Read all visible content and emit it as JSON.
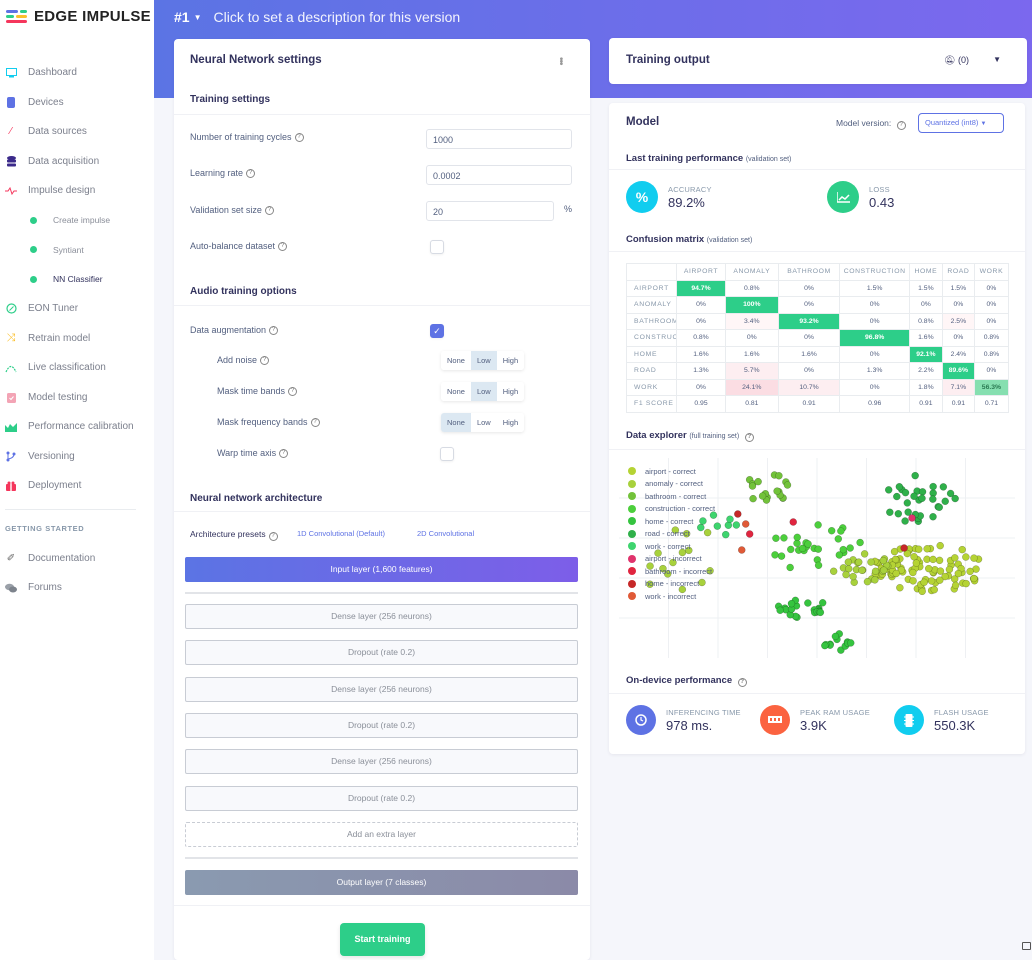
{
  "brand": {
    "name": "EDGE IMPULSE"
  },
  "sidebar": {
    "items": [
      {
        "label": "Dashboard",
        "icon": "monitor-icon",
        "color": "#11cdef"
      },
      {
        "label": "Devices",
        "icon": "device-icon",
        "color": "#5e72e4"
      },
      {
        "label": "Data sources",
        "icon": "data-sources-icon",
        "color": "#f5365c"
      },
      {
        "label": "Data acquisition",
        "icon": "database-icon",
        "color": "#3b2a8a"
      },
      {
        "label": "Impulse design",
        "icon": "pulse-icon",
        "color": "#f5365c"
      }
    ],
    "sub_items": [
      {
        "label": "Create impulse"
      },
      {
        "label": "Syntiant"
      },
      {
        "label": "NN Classifier",
        "active": true
      }
    ],
    "items2": [
      {
        "label": "EON Tuner",
        "icon": "compass-icon",
        "color": "#2dce89"
      },
      {
        "label": "Retrain model",
        "icon": "shuffle-icon",
        "color": "#fbc02d"
      },
      {
        "label": "Live classification",
        "icon": "live-icon",
        "color": "#2dce89"
      },
      {
        "label": "Model testing",
        "icon": "clipboard-check-icon",
        "color": "#f3a4b5"
      },
      {
        "label": "Performance calibration",
        "icon": "chart-area-icon",
        "color": "#2dce89"
      },
      {
        "label": "Versioning",
        "icon": "branch-icon",
        "color": "#5e72e4"
      },
      {
        "label": "Deployment",
        "icon": "gift-icon",
        "color": "#f5365c"
      }
    ],
    "getting_started_heading": "GETTING STARTED",
    "getting_started": [
      {
        "label": "Documentation",
        "icon": "docs-icon"
      },
      {
        "label": "Forums",
        "icon": "forums-icon"
      }
    ]
  },
  "header": {
    "version": "#1",
    "description": "Click to set a description for this version"
  },
  "nn": {
    "title": "Neural Network settings",
    "training_settings_heading": "Training settings",
    "fields": {
      "cycles_label": "Number of training cycles",
      "cycles_value": "1000",
      "lr_label": "Learning rate",
      "lr_value": "0.0002",
      "val_label": "Validation set size",
      "val_value": "20",
      "val_unit": "%",
      "autobalance_label": "Auto-balance dataset",
      "autobalance_checked": false
    },
    "audio_heading": "Audio training options",
    "audio": {
      "augmentation_label": "Data augmentation",
      "augmentation_checked": true,
      "options": [
        "None",
        "Low",
        "High"
      ],
      "add_noise_label": "Add noise",
      "add_noise_selected": "Low",
      "mask_time_label": "Mask time bands",
      "mask_time_selected": "Low",
      "mask_freq_label": "Mask frequency bands",
      "mask_freq_selected": "None",
      "warp_label": "Warp time axis",
      "warp_checked": false
    },
    "arch_heading": "Neural network architecture",
    "presets_label": "Architecture presets",
    "presets": [
      "1D Convolutional (Default)",
      "2D Convolutional"
    ],
    "input_layer": "Input layer (1,600 features)",
    "layers": [
      "Dense layer (256 neurons)",
      "Dropout (rate 0.2)",
      "Dense layer (256 neurons)",
      "Dropout (rate 0.2)",
      "Dense layer (256 neurons)",
      "Dropout (rate 0.2)"
    ],
    "add_layer": "Add an extra layer",
    "output_layer": "Output layer (7 classes)",
    "start_button": "Start training"
  },
  "output": {
    "title": "Training output",
    "notifications": "(0)"
  },
  "model": {
    "title": "Model",
    "version_label": "Model version:",
    "version_value": "Quantized (int8)",
    "last_perf_title": "Last training performance",
    "last_perf_sub": "(validation set)",
    "accuracy_label": "ACCURACY",
    "accuracy_value": "89.2%",
    "loss_label": "LOSS",
    "loss_value": "0.43",
    "cm_title": "Confusion matrix",
    "cm_sub": "(validation set)",
    "cm_columns": [
      "AIRPORT",
      "ANOMALY",
      "BATHROOM",
      "CONSTRUCTION",
      "HOME",
      "ROAD",
      "WORK"
    ],
    "cm_rows": [
      {
        "label": "AIRPORT",
        "values": [
          "94.7%",
          "0.8%",
          "0%",
          "1.5%",
          "1.5%",
          "1.5%",
          "0%"
        ]
      },
      {
        "label": "ANOMALY",
        "values": [
          "0%",
          "100%",
          "0%",
          "0%",
          "0%",
          "0%",
          "0%"
        ]
      },
      {
        "label": "BATHROOM",
        "values": [
          "0%",
          "3.4%",
          "93.2%",
          "0%",
          "0.8%",
          "2.5%",
          "0%"
        ]
      },
      {
        "label": "CONSTRUCTION",
        "values": [
          "0.8%",
          "0%",
          "0%",
          "96.8%",
          "1.6%",
          "0%",
          "0.8%"
        ]
      },
      {
        "label": "HOME",
        "values": [
          "1.6%",
          "1.6%",
          "1.6%",
          "0%",
          "92.1%",
          "2.4%",
          "0.8%"
        ]
      },
      {
        "label": "ROAD",
        "values": [
          "1.3%",
          "5.7%",
          "0%",
          "1.3%",
          "2.2%",
          "89.6%",
          "0%"
        ]
      },
      {
        "label": "WORK",
        "values": [
          "0%",
          "24.1%",
          "10.7%",
          "0%",
          "1.8%",
          "7.1%",
          "56.3%"
        ]
      }
    ],
    "f1_label": "F1 SCORE",
    "f1_values": [
      "0.95",
      "0.81",
      "0.91",
      "0.96",
      "0.91",
      "0.91",
      "0.71"
    ],
    "explorer_title": "Data explorer",
    "explorer_sub": "(full training set)",
    "legend": [
      {
        "label": "airport - correct",
        "color": "#b5d334"
      },
      {
        "label": "anomaly - correct",
        "color": "#a8d13c"
      },
      {
        "label": "bathroom - correct",
        "color": "#72c23a"
      },
      {
        "label": "construction - correct",
        "color": "#4ccf3c"
      },
      {
        "label": "home - correct",
        "color": "#35c43f"
      },
      {
        "label": "road - correct",
        "color": "#2fb04a"
      },
      {
        "label": "work - correct",
        "color": "#3ed46e"
      },
      {
        "label": "airport - incorrect",
        "color": "#e0336c"
      },
      {
        "label": "bathroom - incorrect",
        "color": "#e0253f"
      },
      {
        "label": "home - incorrect",
        "color": "#c62828"
      },
      {
        "label": "work - incorrect",
        "color": "#e05a37"
      }
    ],
    "ondevice_title": "On-device performance",
    "inferencing_label": "INFERENCING TIME",
    "inferencing_value": "978 ms.",
    "ram_label": "PEAK RAM USAGE",
    "ram_value": "3.9K",
    "flash_label": "FLASH USAGE",
    "flash_value": "550.3K"
  }
}
